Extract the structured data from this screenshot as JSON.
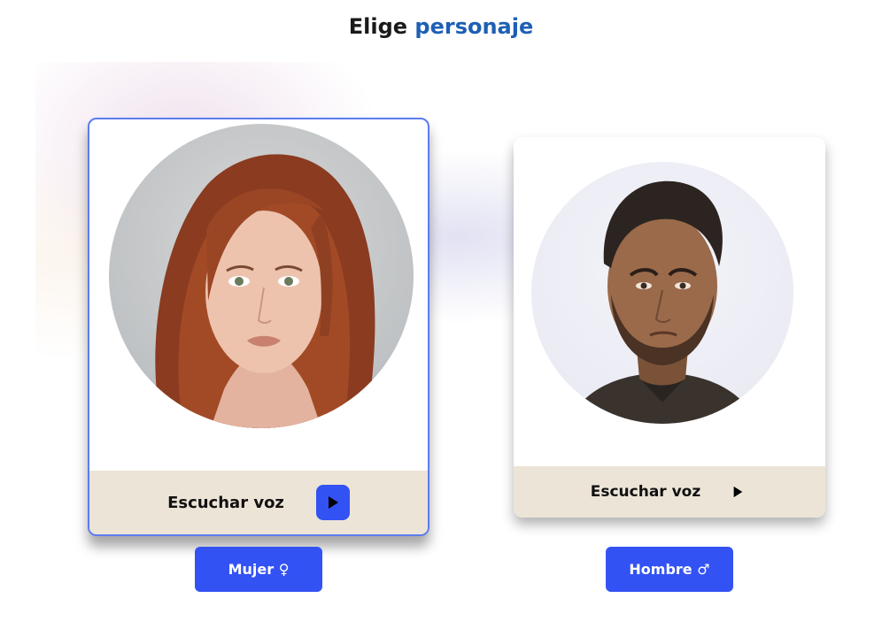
{
  "header": {
    "title_prefix": "Elige",
    "title_accent": "personaje"
  },
  "characters": [
    {
      "id": "mujer",
      "voice_label": "Escuchar voz",
      "select_label": "Mujer ♀",
      "selected": true,
      "portrait_icon": "woman-portrait-icon"
    },
    {
      "id": "hombre",
      "voice_label": "Escuchar voz",
      "select_label": "Hombre ♂",
      "selected": false,
      "portrait_icon": "man-portrait-icon"
    }
  ],
  "colors": {
    "accent": "#3352f4",
    "title_accent": "#1e5fb4",
    "footer_bg": "#ece4d6",
    "selected_border": "#5d7cf0"
  }
}
